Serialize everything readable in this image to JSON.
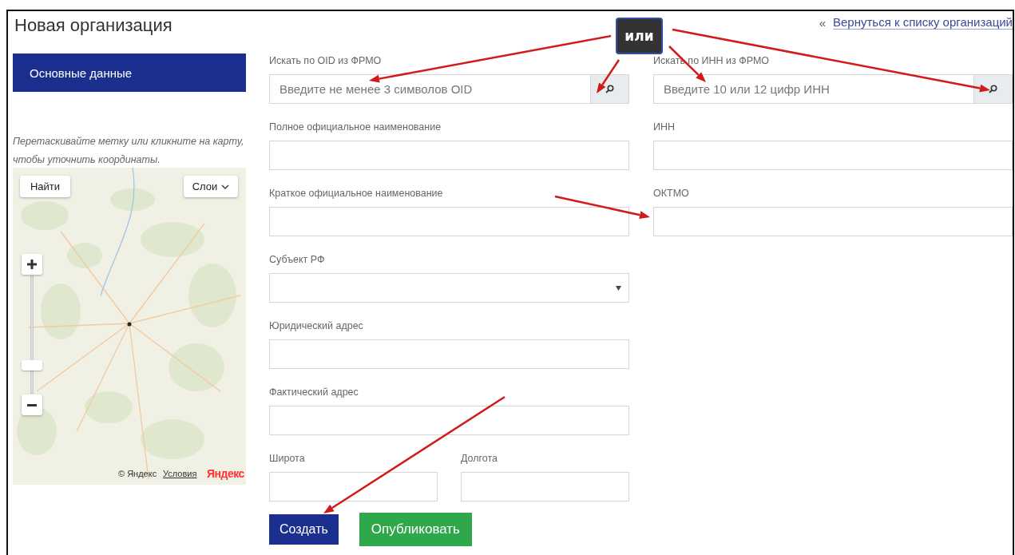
{
  "page_title": "Новая организация",
  "back_link": {
    "icon": "«",
    "label": "Вернуться к списку организаций"
  },
  "annotation": {
    "label": "или"
  },
  "sidebar": {
    "items": [
      {
        "label": "Основные данные",
        "selected": true
      }
    ]
  },
  "map": {
    "hint": "Перетаскивайте метку или кликните на карту, чтобы уточнить координаты.",
    "find_button": "Найти",
    "layers_button": "Слои",
    "zoom_slider": {
      "level": 0.22
    },
    "copyright": "© Яндекс",
    "terms_link": "Условия",
    "logo": "Яндекс"
  },
  "form": {
    "left_fields": [
      {
        "label": "Искать по OID из ФРМО",
        "kind": "search",
        "placeholder": "Введите не менее 3 символов OID"
      },
      {
        "label": "Полное официальное наименование",
        "kind": "text"
      },
      {
        "label": "Краткое официальное наименование",
        "kind": "text"
      },
      {
        "label": "Субъект РФ",
        "kind": "select"
      },
      {
        "label": "Юридический адрес",
        "kind": "text"
      },
      {
        "label": "Фактический адрес",
        "kind": "text"
      }
    ],
    "coordinates": [
      {
        "label": "Широта",
        "kind": "text"
      },
      {
        "label": "Долгота",
        "kind": "text"
      }
    ],
    "right_fields": [
      {
        "label": "Искать по ИНН из ФРМО",
        "kind": "search",
        "placeholder": "Введите 10 или 12 цифр ИНН"
      },
      {
        "label": "ИНН",
        "kind": "text"
      },
      {
        "label": "ОКТМО",
        "kind": "text"
      }
    ],
    "buttons": [
      {
        "label": "Создать",
        "kind": "primary"
      },
      {
        "label": "Опубликовать",
        "kind": "success"
      }
    ]
  }
}
